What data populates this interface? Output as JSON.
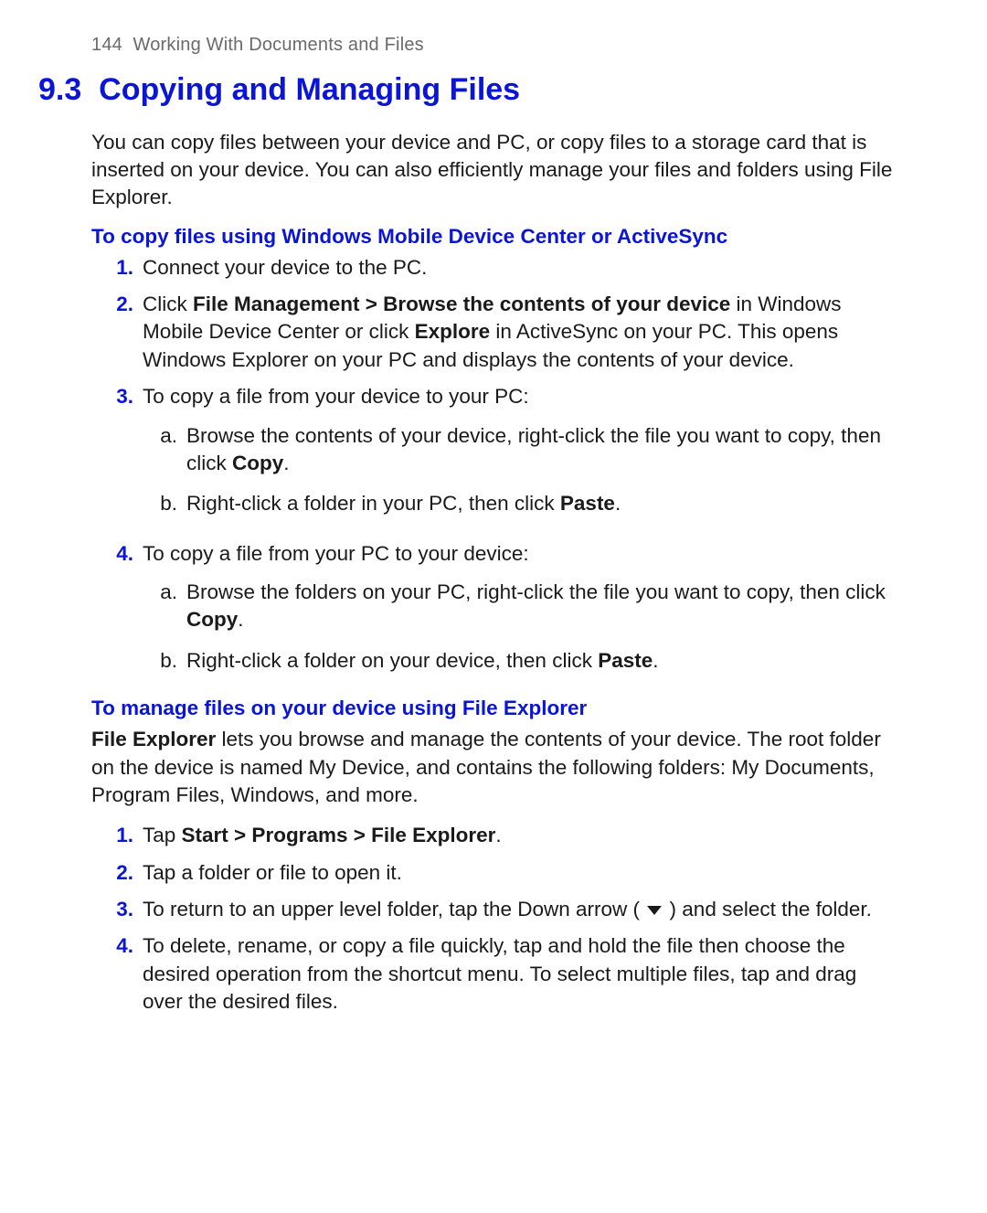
{
  "header": {
    "page_number": "144",
    "chapter_title": "Working With Documents and Files"
  },
  "section": {
    "number": "9.3",
    "title": "Copying and Managing Files"
  },
  "intro": "You can copy files between your device and PC, or copy files to a storage card that is inserted on your device. You can also efficiently manage your files and folders using File Explorer.",
  "sub1": {
    "heading": "To copy files using Windows Mobile Device Center or ActiveSync",
    "steps": [
      {
        "n": "1.",
        "text": "Connect your device to the PC."
      },
      {
        "n": "2.",
        "pre": "Click ",
        "b1": "File Management > Browse the contents of your device",
        "mid1": " in Windows Mobile Device Center or click ",
        "b2": "Explore",
        "post": " in ActiveSync on your PC. This opens Windows Explorer on your PC and displays the contents of your device."
      },
      {
        "n": "3.",
        "text": "To copy a file from your device to your PC:",
        "sub": [
          {
            "m": "a.",
            "pre": "Browse the contents of your device, right-click the file you want to copy, then click ",
            "bold": "Copy",
            "post": "."
          },
          {
            "m": "b.",
            "pre": "Right-click a folder in your PC, then click ",
            "bold": "Paste",
            "post": "."
          }
        ]
      },
      {
        "n": "4.",
        "text": "To copy a file from your PC to your device:",
        "sub": [
          {
            "m": "a.",
            "pre": "Browse the folders on your PC, right-click the file you want to copy, then click ",
            "bold": "Copy",
            "post": "."
          },
          {
            "m": "b.",
            "pre": "Right-click a folder on your device, then click ",
            "bold": "Paste",
            "post": "."
          }
        ]
      }
    ]
  },
  "sub2": {
    "heading": "To manage files on your device using File Explorer",
    "lead_bold": "File Explorer",
    "lead_rest": " lets you browse and manage the contents of your device. The root folder on the device is named My Device, and contains the following folders: My Documents, Program Files, Windows, and more.",
    "steps": [
      {
        "n": "1.",
        "pre": "Tap ",
        "bold": "Start > Programs > File Explorer",
        "post": "."
      },
      {
        "n": "2.",
        "text": "Tap a folder or file to open it."
      },
      {
        "n": "3.",
        "pre": "To return to an upper level folder, tap the Down arrow ( ",
        "icon": "down-arrow",
        "post": " ) and select the folder."
      },
      {
        "n": "4.",
        "text": "To delete, rename, or copy a file quickly, tap and hold the file then choose the desired operation from the shortcut menu. To select multiple files, tap and drag over the desired files."
      }
    ]
  }
}
